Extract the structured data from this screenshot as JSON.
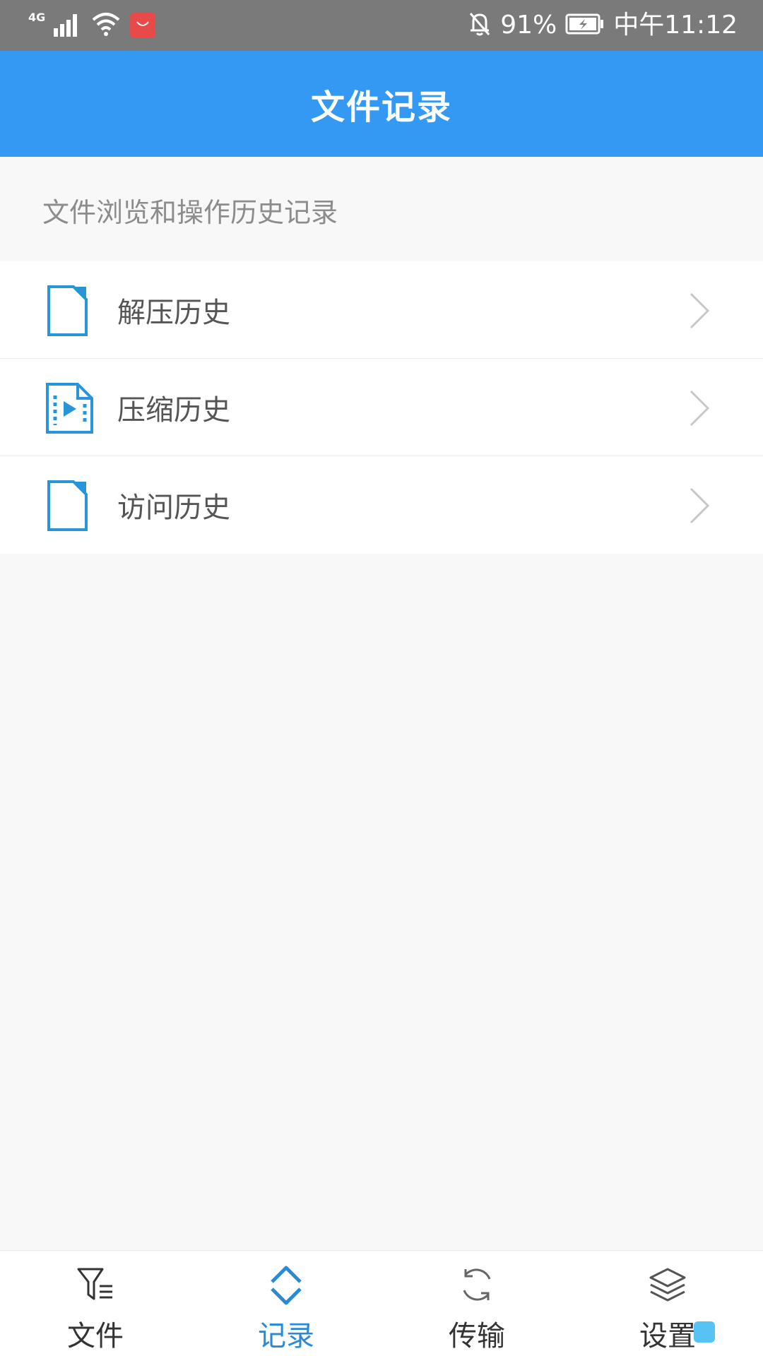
{
  "status_bar": {
    "network_type": "4G",
    "battery_percent": "91%",
    "time": "中午11:12",
    "icons": [
      "signal-icon",
      "wifi-icon",
      "app-badge-icon",
      "mute-bell-icon",
      "battery-charging-icon"
    ]
  },
  "header": {
    "title": "文件记录"
  },
  "caption": "文件浏览和操作历史记录",
  "list": {
    "items": [
      {
        "label": "解压历史",
        "icon": "document-icon"
      },
      {
        "label": "压缩历史",
        "icon": "video-file-icon"
      },
      {
        "label": "访问历史",
        "icon": "document-icon"
      }
    ]
  },
  "bottom_nav": {
    "items": [
      {
        "label": "文件",
        "icon": "filter-list-icon",
        "active": false
      },
      {
        "label": "记录",
        "icon": "expand-chevrons-icon",
        "active": true
      },
      {
        "label": "传输",
        "icon": "sync-icon",
        "active": false
      },
      {
        "label": "设置",
        "icon": "layers-icon",
        "active": false
      }
    ]
  },
  "colors": {
    "header_bg": "#3399f3",
    "accent": "#2a8ad4",
    "icon_blue": "#2795d6",
    "page_bg": "#f8f8f8",
    "status_bar_bg": "#7a7a7a"
  }
}
